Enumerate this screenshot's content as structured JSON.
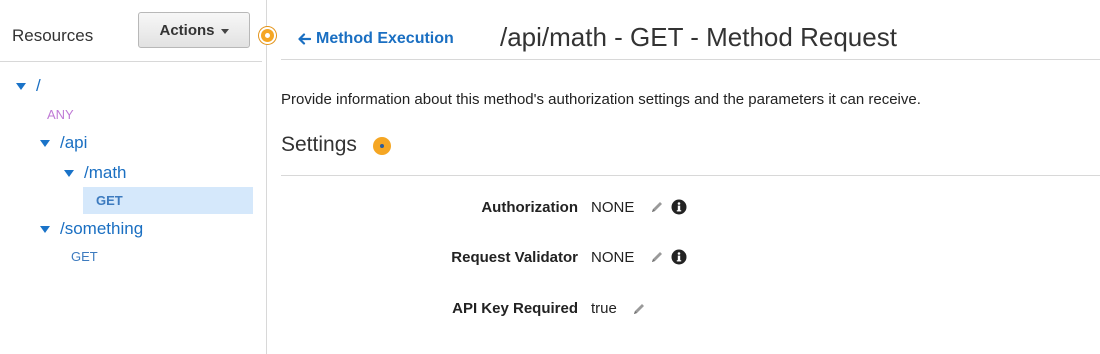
{
  "sidebar": {
    "title": "Resources",
    "actions_label": "Actions",
    "tree": {
      "root": "/",
      "root_method": "ANY",
      "api": "/api",
      "math": "/math",
      "math_method": "GET",
      "something": "/something",
      "something_method": "GET"
    }
  },
  "header": {
    "back_link": "Method Execution",
    "title": "/api/math - GET - Method Request"
  },
  "description": "Provide information about this method's authorization settings and the parameters it can receive.",
  "settings": {
    "heading": "Settings",
    "fields": [
      {
        "label": "Authorization",
        "value": "NONE"
      },
      {
        "label": "Request Validator",
        "value": "NONE"
      },
      {
        "label": "API Key Required",
        "value": "true"
      }
    ]
  },
  "colors": {
    "link": "#1a6fc2",
    "accent_orange": "#f5a623",
    "selected_bg": "#d5e8fb",
    "any_method": "#c07bd6"
  },
  "icons": [
    "chevron-down-icon",
    "arrow-left-icon",
    "pencil-icon",
    "info-icon",
    "tree-expand-icon"
  ]
}
